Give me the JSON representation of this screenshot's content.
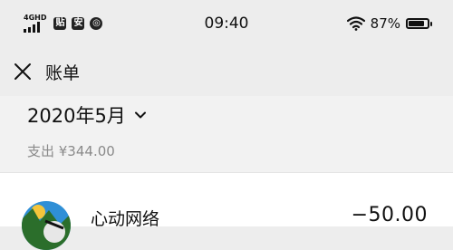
{
  "status_bar": {
    "network_type": "4G",
    "network_hd": "HD",
    "app_icons": [
      {
        "icon": "tie-app-icon",
        "glyph": "贴"
      },
      {
        "icon": "android-app-icon",
        "glyph": "安"
      },
      {
        "icon": "circle-app-icon",
        "glyph": "◎"
      }
    ],
    "time": "09:40",
    "battery_percent_text": "87%",
    "battery_level": 0.87
  },
  "nav": {
    "title": "账单"
  },
  "summary": {
    "month": "2020年5月",
    "expense": "支出 ¥344.00"
  },
  "bills": [
    {
      "merchant": "心动网络",
      "amount": "−50.00",
      "avatar": "merchant-logo"
    }
  ],
  "colors": {
    "page_bg": "#ededed",
    "section_bg": "#f2f2f2",
    "row_bg": "#ffffff",
    "muted_text": "#8a8a8a"
  }
}
